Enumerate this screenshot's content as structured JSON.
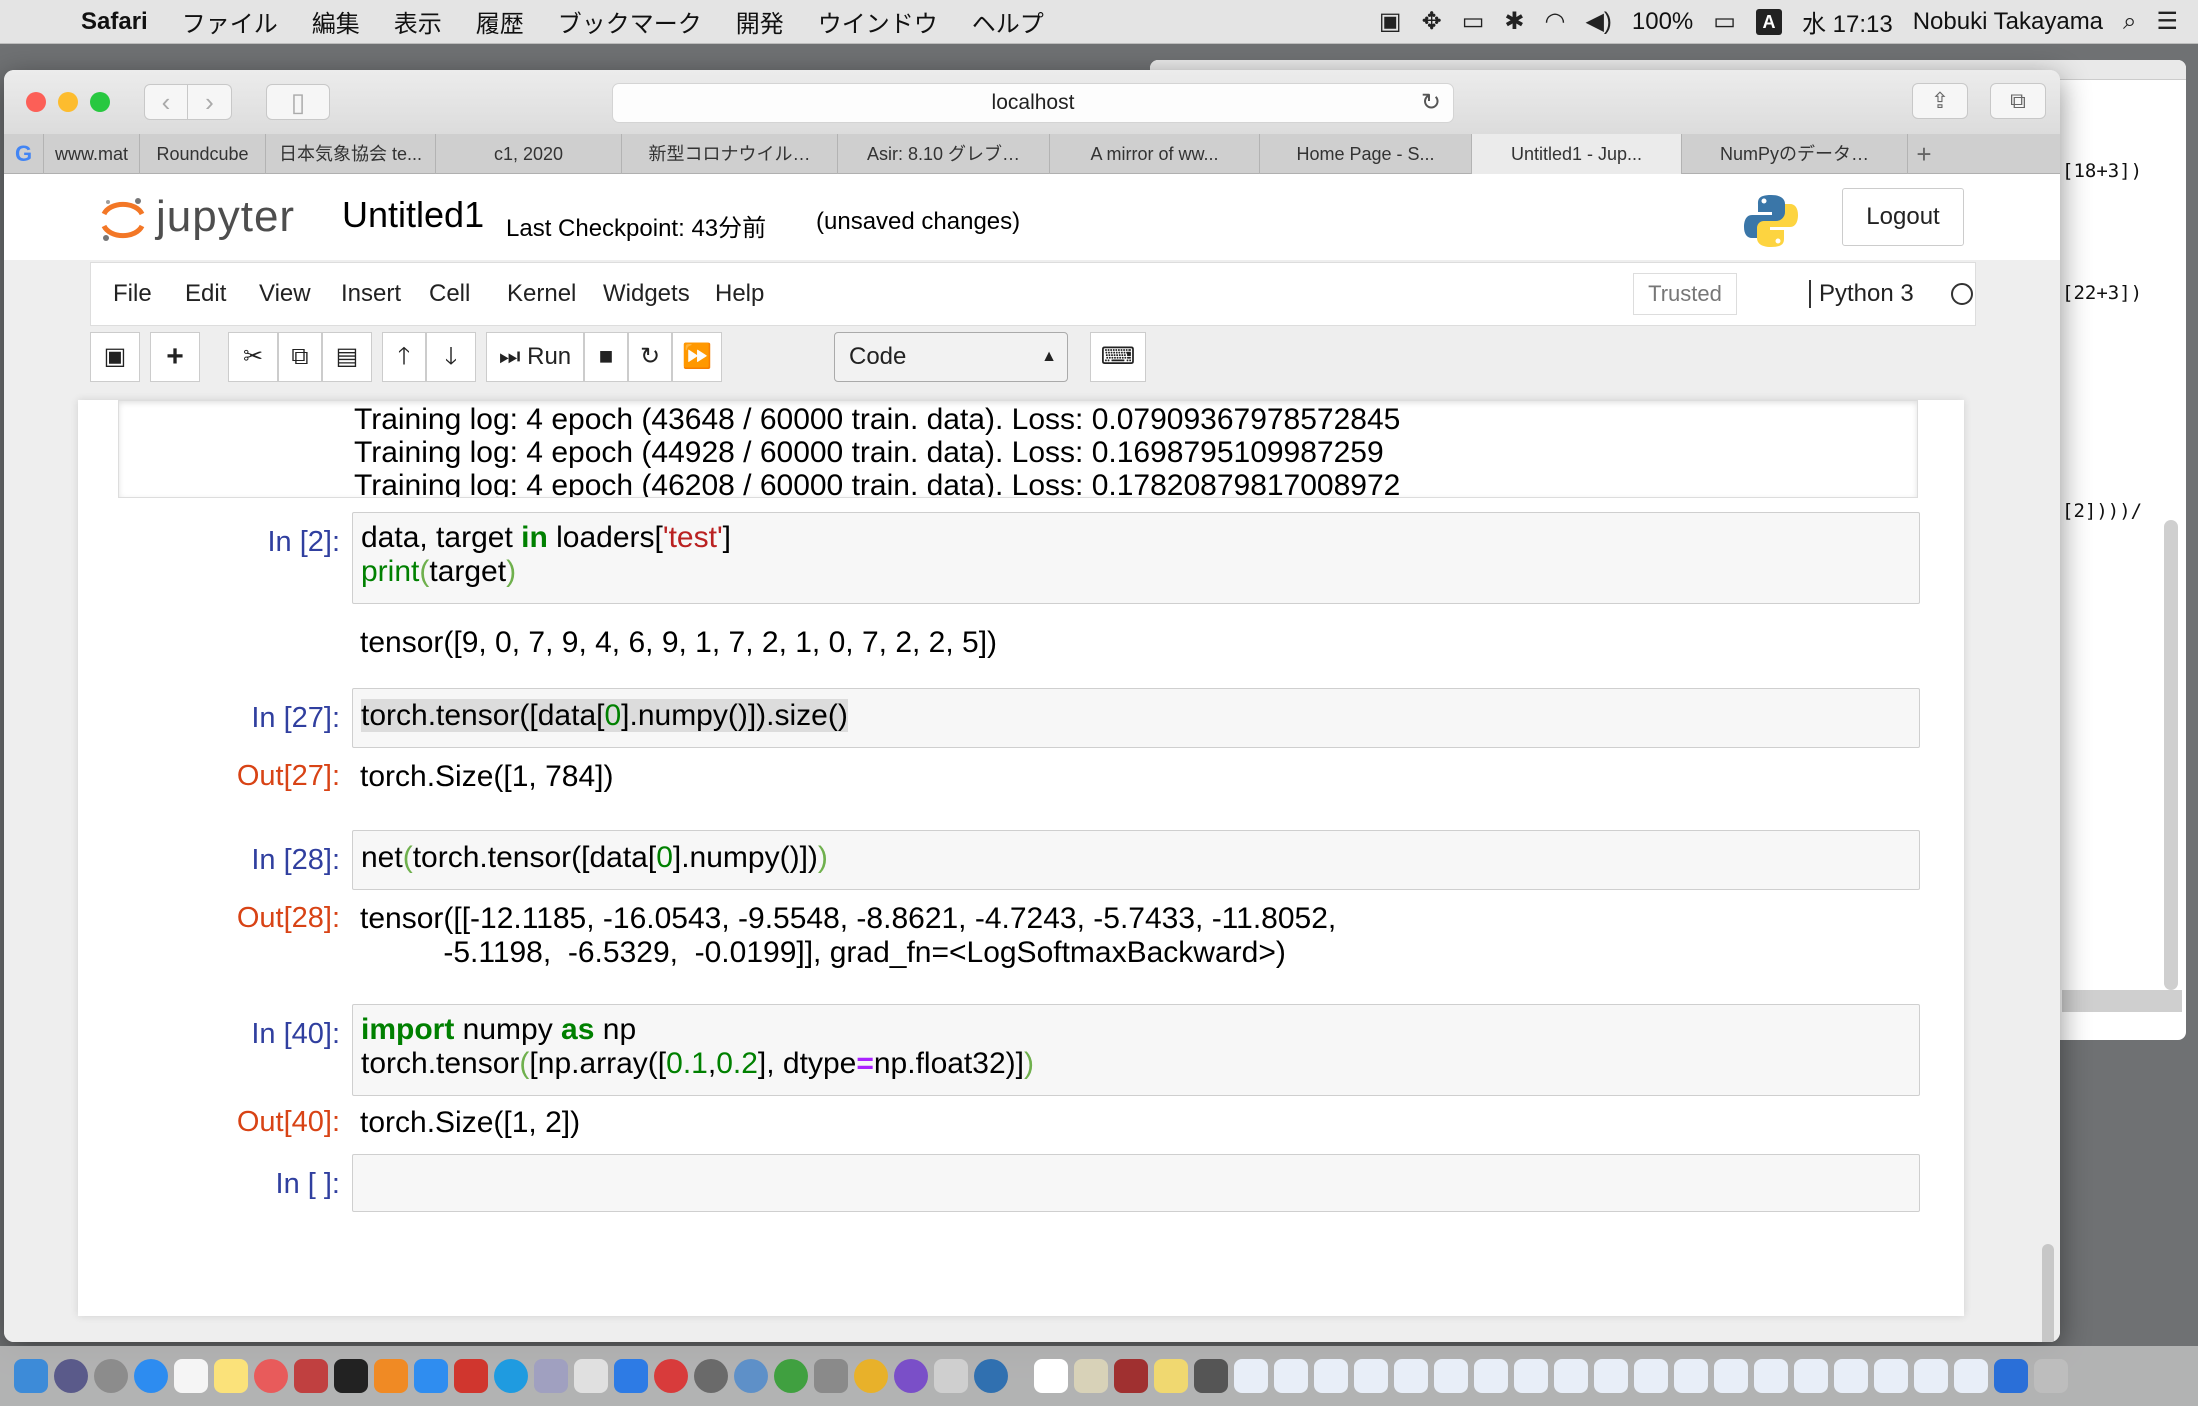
{
  "menubar": {
    "app": "Safari",
    "items": [
      "ファイル",
      "編集",
      "表示",
      "履歴",
      "ブックマーク",
      "開発",
      "ウインドウ",
      "ヘルプ"
    ],
    "battery": "100%",
    "clock": "水 17:13",
    "user": "Nobuki Takayama",
    "input_method": "A"
  },
  "background_window": {
    "lines": [
      "[18+3])",
      "[22+3])",
      "[2])))/"
    ]
  },
  "safari": {
    "url": "localhost",
    "tabs": [
      "www.mat",
      "Roundcube",
      "日本気象協会 te...",
      "c1, 2020",
      "新型コロナウイル…",
      "Asir: 8.10 グレブ…",
      "A mirror of ww...",
      "Home Page - S...",
      "Untitled1 - Jup...",
      "NumPyのデータ…"
    ],
    "active_tab": 8
  },
  "jupyter": {
    "logo_text": "jupyter",
    "notebook_name": "Untitled1",
    "checkpoint": "Last Checkpoint: 43分前",
    "unsaved": "(unsaved changes)",
    "logout": "Logout",
    "menu": [
      "File",
      "Edit",
      "View",
      "Insert",
      "Cell",
      "Kernel",
      "Widgets",
      "Help"
    ],
    "trusted": "Trusted",
    "kernel": "Python 3",
    "toolbar": {
      "run": "Run",
      "cell_type": "Code"
    }
  },
  "cells": {
    "scroll_output": [
      "Training log: 4 epoch (43648 / 60000 train. data). Loss: 0.07909367978572845",
      "Training log: 4 epoch (44928 / 60000 train. data). Loss: 0.1698795109987259",
      "Training log: 4 epoch (46208 / 60000 train. data). Loss: 0.17820879817008972"
    ],
    "c2": {
      "prompt": "In [2]:",
      "line1": {
        "a": "data, target ",
        "b": "in",
        "c": " loaders[",
        "d": "'test'",
        "e": "]"
      },
      "line2": {
        "a": "print",
        "b": "(",
        "c": "target",
        "d": ")"
      },
      "stdout": "tensor([9, 0, 7, 9, 4, 6, 9, 1, 7, 2, 1, 0, 7, 2, 2, 5])"
    },
    "c27": {
      "prompt": "In [27]:",
      "out_prompt": "Out[27]:",
      "code": {
        "a": "torch.tensor([data[",
        "b": "0",
        "c": "].numpy()]).size()"
      },
      "output": "torch.Size([1, 784])"
    },
    "c28": {
      "prompt": "In [28]:",
      "out_prompt": "Out[28]:",
      "code": {
        "a": "net",
        "b": "(",
        "c": "torch.tensor([data[",
        "d": "0",
        "e": "].numpy()])",
        "f": ")"
      },
      "output1": "tensor([[-12.1185, -16.0543,  -9.5548,  -8.8621,  -4.7243,  -5.7433, -11.8052,",
      "output2": "          -5.1198,  -6.5329,  -0.0199]], grad_fn=<LogSoftmaxBackward>)"
    },
    "c40": {
      "prompt": "In [40]:",
      "out_prompt": "Out[40]:",
      "line1": {
        "a": "import",
        "b": " numpy ",
        "c": "as",
        "d": " np"
      },
      "line2": {
        "a": "torch.tensor",
        "b": "(",
        "c": "[np.array([",
        "d": "0.1",
        "e": ",",
        "f": "0.2",
        "g": "], dtype",
        "h": "=",
        "i": "np.float32)]",
        "j": ")"
      },
      "output": "torch.Size([1, 2])"
    },
    "empty": {
      "prompt": "In [ ]:"
    }
  }
}
